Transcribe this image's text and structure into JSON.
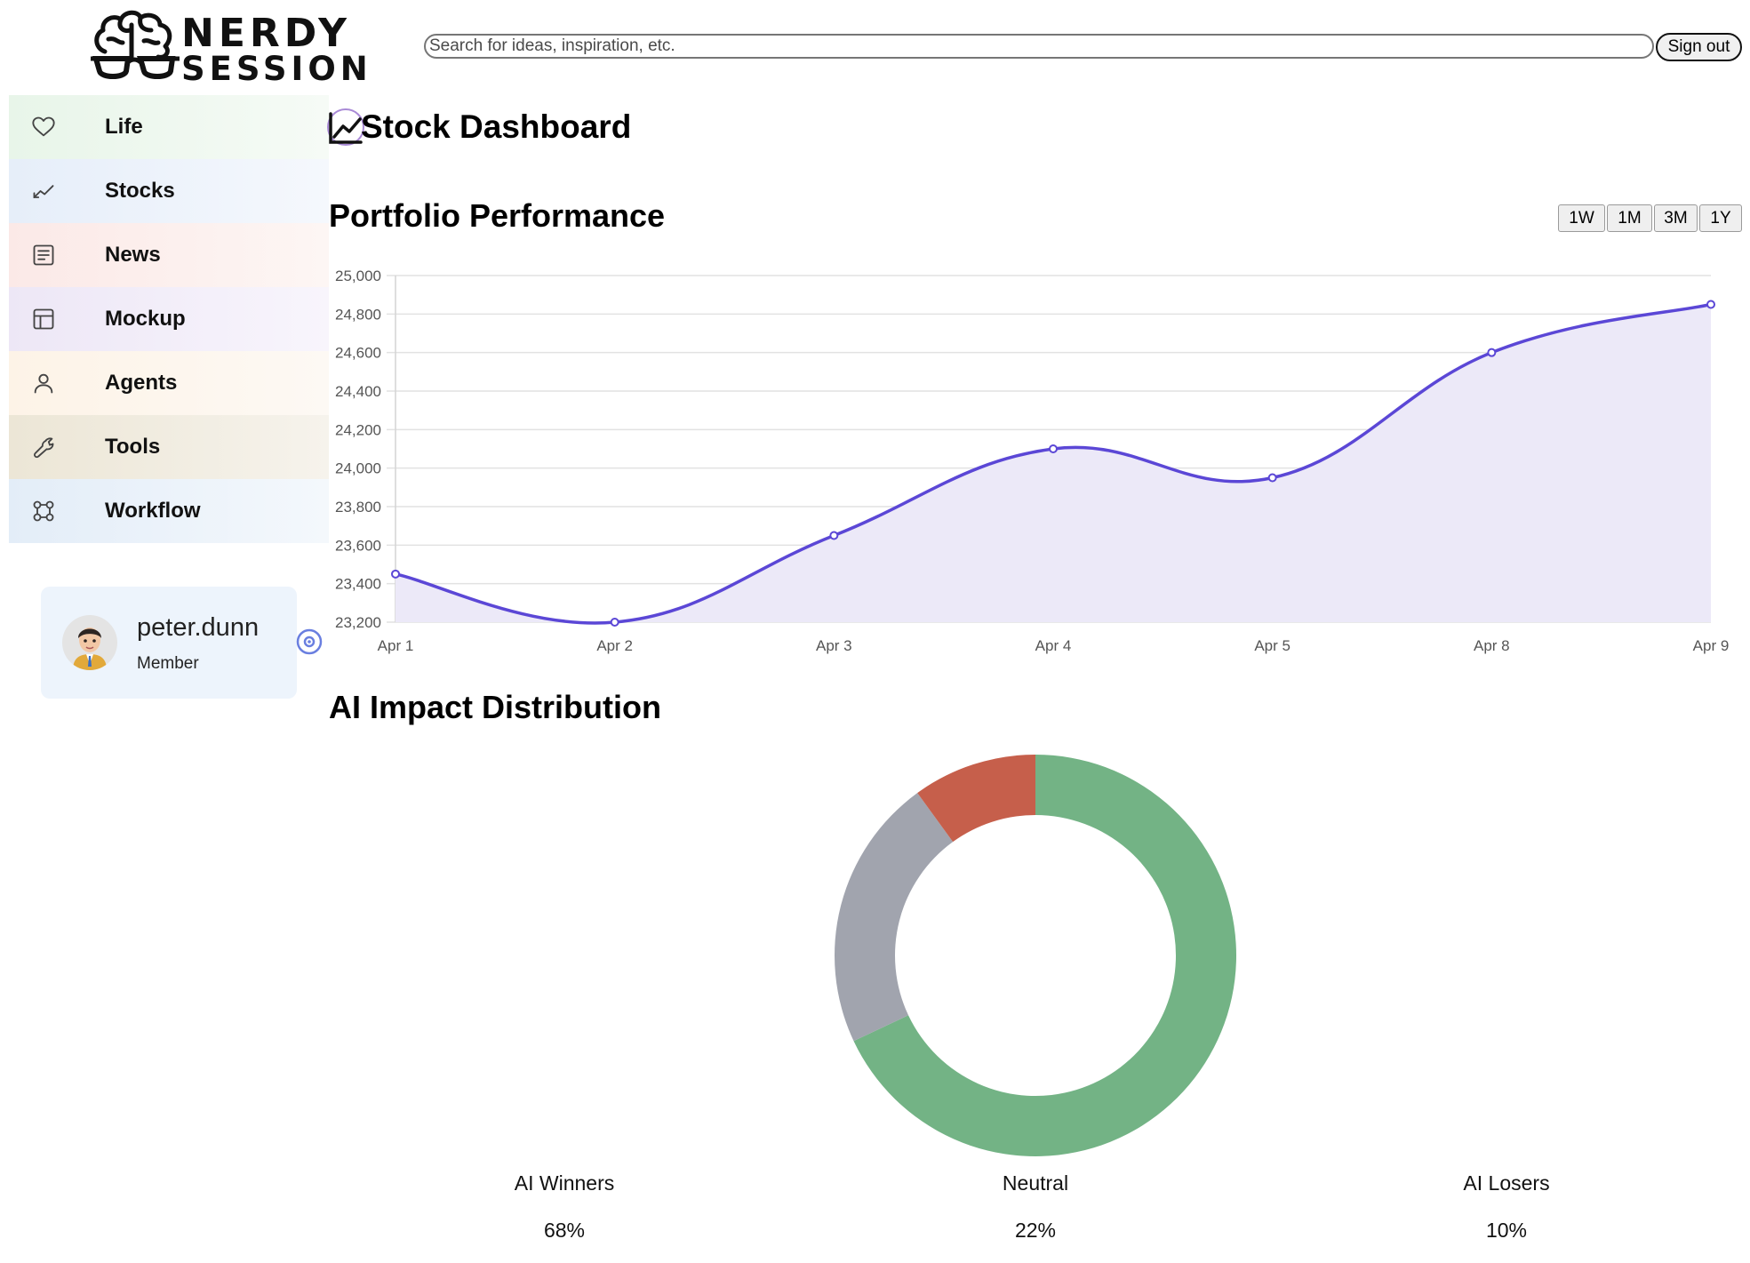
{
  "brand": {
    "line1": "NERDY",
    "line2": "SESSION"
  },
  "search": {
    "placeholder": "Search for ideas, inspiration, etc."
  },
  "header": {
    "signout_label": "Sign out"
  },
  "sidebar": {
    "items": [
      {
        "label": "Life",
        "icon": "heart-icon"
      },
      {
        "label": "Stocks",
        "icon": "trend-icon"
      },
      {
        "label": "News",
        "icon": "newspaper-icon"
      },
      {
        "label": "Mockup",
        "icon": "layout-icon"
      },
      {
        "label": "Agents",
        "icon": "person-icon"
      },
      {
        "label": "Tools",
        "icon": "wrench-icon"
      },
      {
        "label": "Workflow",
        "icon": "workflow-icon"
      }
    ]
  },
  "user": {
    "name": "peter.dunn",
    "role": "Member"
  },
  "main": {
    "page_title": "Stock Dashboard",
    "portfolio_title": "Portfolio Performance",
    "ranges": [
      "1W",
      "1M",
      "3M",
      "1Y"
    ],
    "impact_title": "AI Impact Distribution"
  },
  "colors": {
    "line": "#5b47d6",
    "area": "#ece9f8",
    "winners": "#73b385",
    "neutral": "#a1a4ae",
    "losers": "#c65f4b"
  },
  "chart_data": [
    {
      "type": "area",
      "x": [
        "Apr 1",
        "Apr 2",
        "Apr 3",
        "Apr 4",
        "Apr 5",
        "Apr 8",
        "Apr 9"
      ],
      "values": [
        23450,
        23200,
        23650,
        24100,
        23950,
        24600,
        24850
      ],
      "ylim": [
        23200,
        25000
      ],
      "yticks": [
        "23,200",
        "23,400",
        "23,600",
        "23,800",
        "24,000",
        "24,200",
        "24,400",
        "24,600",
        "24,800",
        "25,000"
      ],
      "grid": true
    },
    {
      "type": "pie",
      "categories": [
        "AI Winners",
        "Neutral",
        "AI Losers"
      ],
      "values": [
        68,
        22,
        10
      ],
      "labels": [
        "68%",
        "22%",
        "10%"
      ]
    }
  ]
}
